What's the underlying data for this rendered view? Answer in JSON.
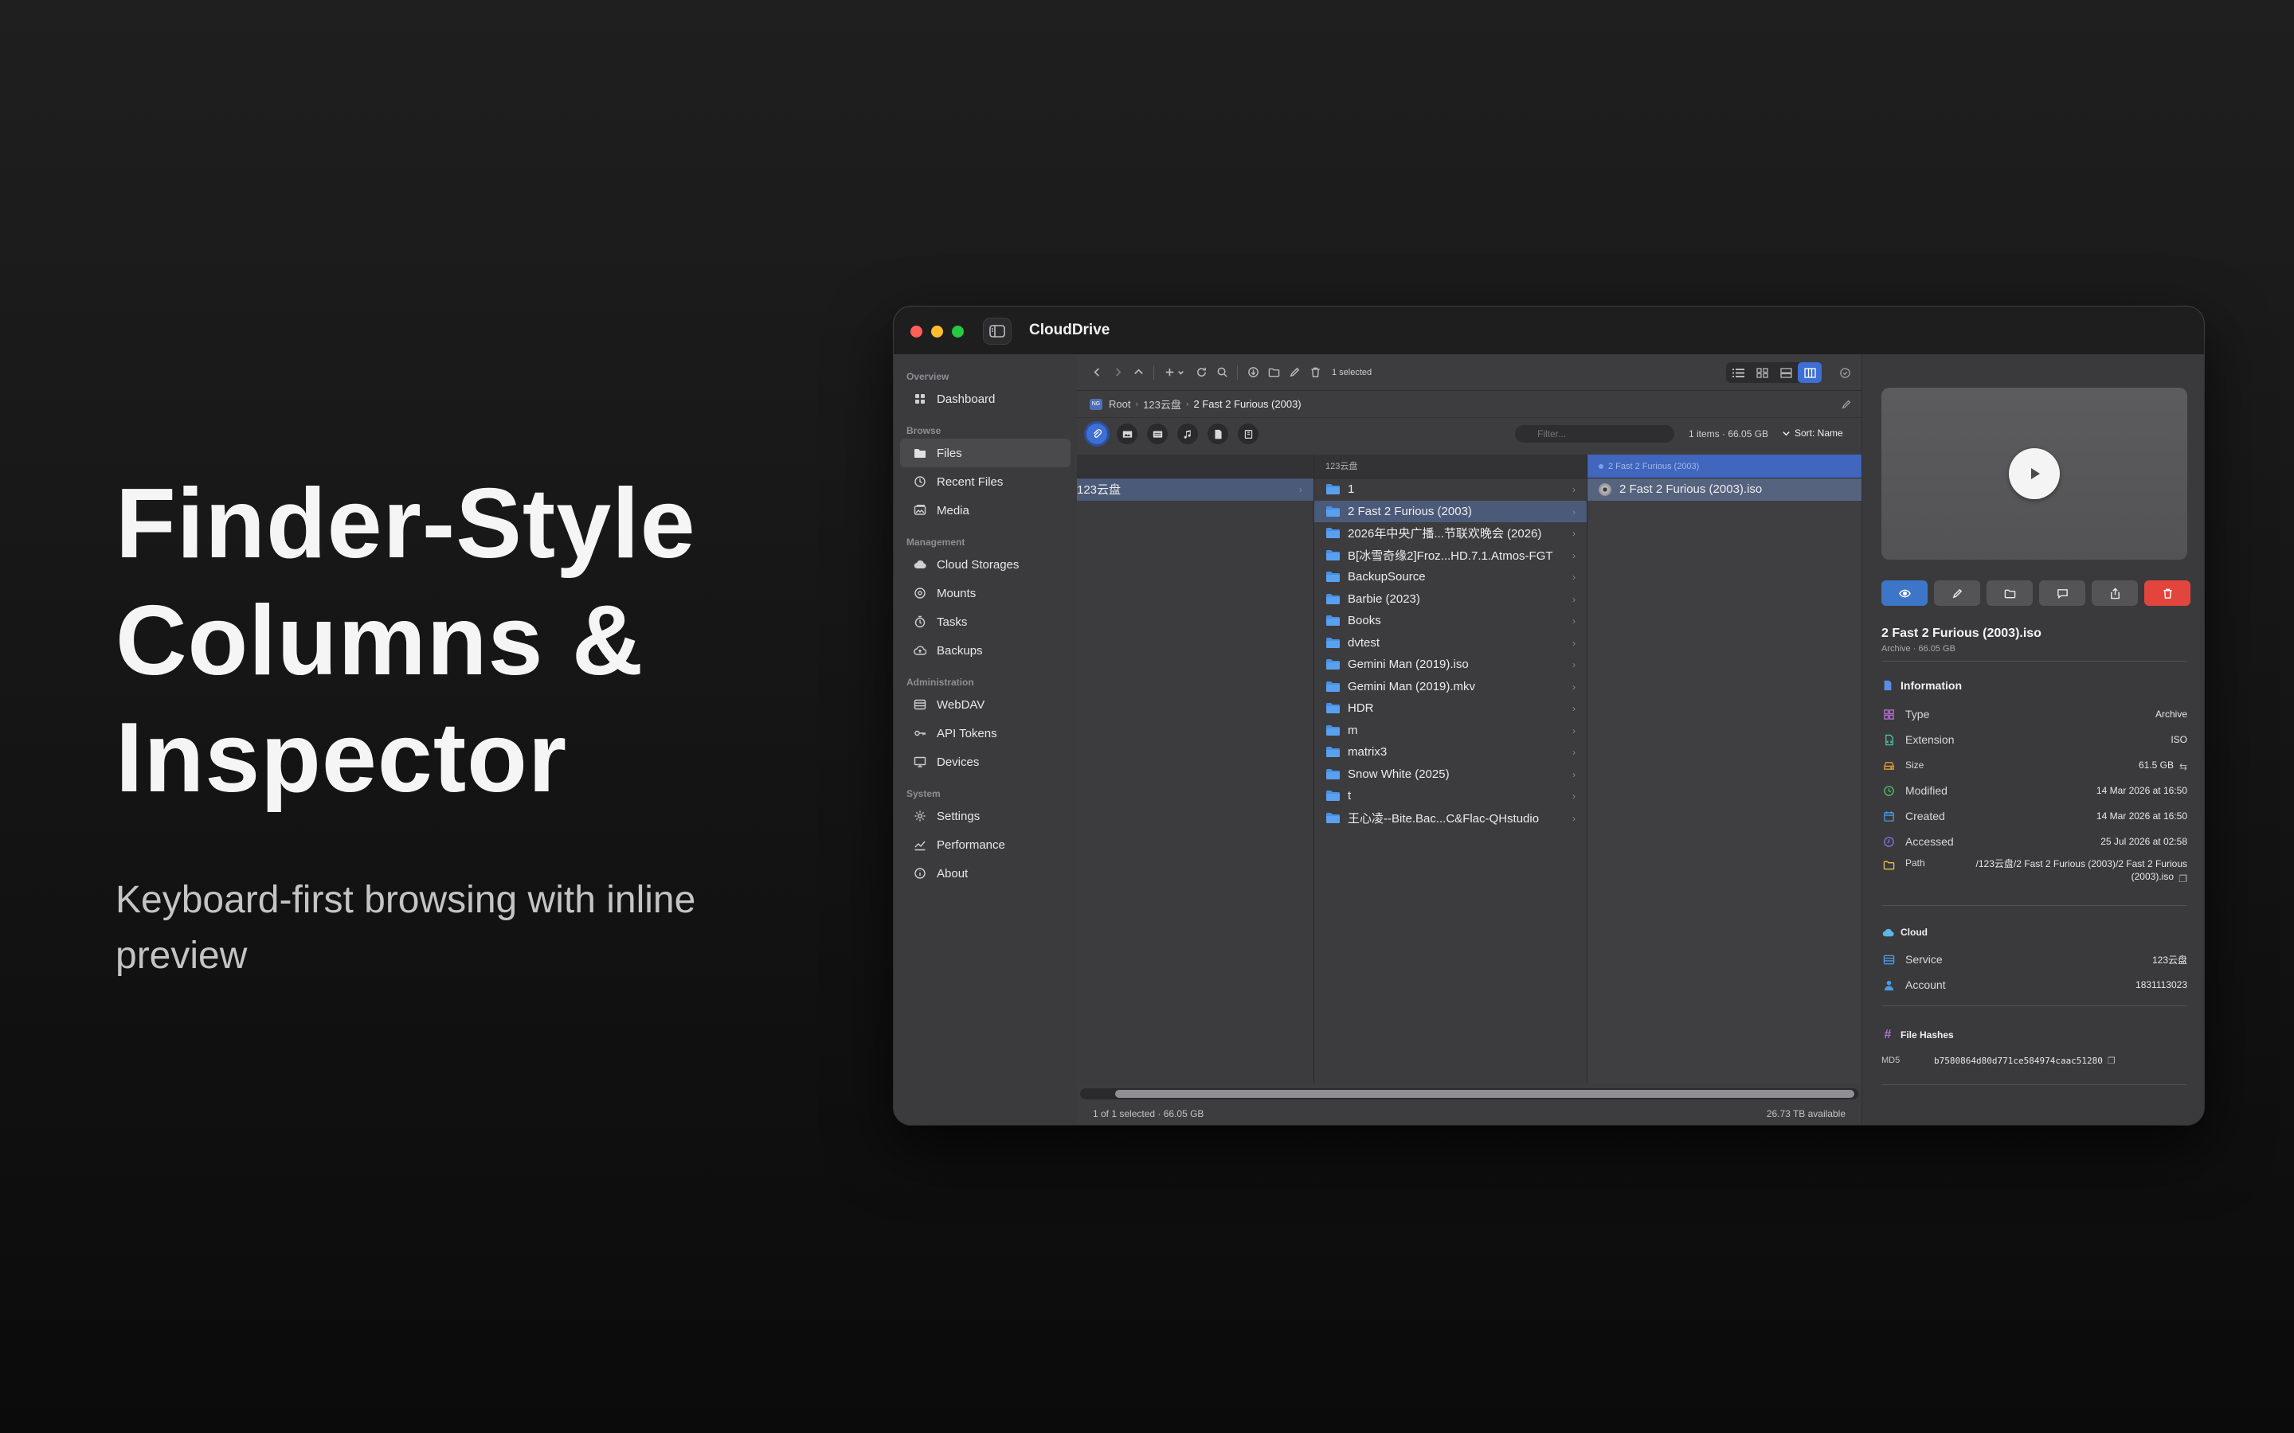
{
  "hero": {
    "title_line1": "Finder-Style",
    "title_line2": "Columns &",
    "title_line3": "Inspector",
    "subtitle_line1": "Keyboard-first browsing with inline",
    "subtitle_line2": "preview"
  },
  "window": {
    "title": "CloudDrive",
    "colors": {
      "accent": "#3d6fd6",
      "close": "#ff5f57",
      "minimize": "#febc2e",
      "zoom": "#28c840",
      "delete": "#e2453c"
    }
  },
  "sidebar": {
    "sections": [
      {
        "title": "Overview",
        "items": [
          {
            "label": "Dashboard",
            "icon": "grid-icon"
          }
        ]
      },
      {
        "title": "Browse",
        "items": [
          {
            "label": "Files",
            "icon": "folder-icon",
            "active": true
          },
          {
            "label": "Recent Files",
            "icon": "clock-icon"
          },
          {
            "label": "Media",
            "icon": "photo-icon"
          }
        ]
      },
      {
        "title": "Management",
        "items": [
          {
            "label": "Cloud Storages",
            "icon": "cloud-icon"
          },
          {
            "label": "Mounts",
            "icon": "drive-icon"
          },
          {
            "label": "Tasks",
            "icon": "timer-icon"
          },
          {
            "label": "Backups",
            "icon": "cloud-backup-icon"
          }
        ]
      },
      {
        "title": "Administration",
        "items": [
          {
            "label": "WebDAV",
            "icon": "server-icon"
          },
          {
            "label": "API Tokens",
            "icon": "key-icon"
          },
          {
            "label": "Devices",
            "icon": "monitor-icon"
          }
        ]
      },
      {
        "title": "System",
        "items": [
          {
            "label": "Settings",
            "icon": "gear-icon"
          },
          {
            "label": "Performance",
            "icon": "chart-icon"
          },
          {
            "label": "About",
            "icon": "info-icon"
          }
        ]
      }
    ]
  },
  "toolbar": {
    "selection": "1 selected"
  },
  "pathbar": {
    "disk": "NG",
    "root": "Root",
    "segment1": "123云盘",
    "current": "2 Fast 2 Furious (2003)"
  },
  "filterbar": {
    "placeholder": "Filter...",
    "items_info": "1 items · 66.05 GB",
    "sort": "Sort: Name"
  },
  "columns": {
    "col1": {
      "items": [
        {
          "label": "123云盘",
          "selected": true
        }
      ]
    },
    "col2": {
      "header": "123云盘",
      "items": [
        "1",
        "2 Fast 2 Furious (2003)",
        "2026年中央广播...节联欢晚会 (2026)",
        "B[冰雪奇缘2]Froz...HD.7.1.Atmos-FGT",
        "BackupSource",
        "Barbie (2023)",
        "Books",
        "dvtest",
        "Gemini Man (2019).iso",
        "Gemini Man (2019).mkv",
        "HDR",
        "m",
        "matrix3",
        "Snow White (2025)",
        "t",
        "王心凌--Bite.Bac...C&Flac-QHstudio"
      ],
      "selected_index": 1
    },
    "col3": {
      "header": "2 Fast 2 Furious (2003)",
      "items": [
        "2 Fast 2 Furious (2003).iso"
      ]
    }
  },
  "status": {
    "left": "1 of 1 selected · 66.05 GB",
    "right": "26.73 TB available"
  },
  "inspector": {
    "filename": "2 Fast 2 Furious (2003).iso",
    "subtitle": "Archive · 66.05 GB",
    "information": {
      "title": "Information",
      "rows": [
        {
          "label": "Type",
          "value": "Archive"
        },
        {
          "label": "Extension",
          "value": "ISO"
        },
        {
          "label": "Size",
          "value": "61.5 GB"
        },
        {
          "label": "Modified",
          "value": "14 Mar 2026 at 16:50"
        },
        {
          "label": "Created",
          "value": "14 Mar 2026 at 16:50"
        },
        {
          "label": "Accessed",
          "value": "25 Jul 2026 at 02:58"
        },
        {
          "label": "Path",
          "value": "/123云盘/2 Fast 2 Furious (2003)/2 Fast 2 Furious (2003).iso"
        }
      ]
    },
    "cloud": {
      "title": "Cloud",
      "rows": [
        {
          "label": "Service",
          "value": "123云盘"
        },
        {
          "label": "Account",
          "value": "1831113023"
        }
      ]
    },
    "hashes": {
      "title": "File Hashes",
      "label": "MD5",
      "value": "b7580864d80d771ce584974caac51280"
    }
  }
}
